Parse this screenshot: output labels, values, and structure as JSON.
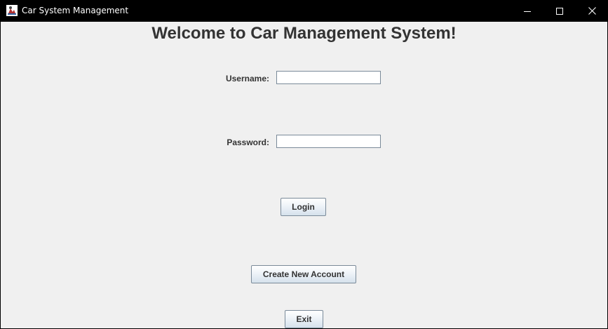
{
  "window": {
    "title": "Car System Management",
    "icon": "app-java-icon"
  },
  "heading": "Welcome to Car Management System!",
  "form": {
    "username_label": "Username:",
    "username_value": "",
    "password_label": "Password:",
    "password_value": ""
  },
  "buttons": {
    "login": "Login",
    "create_account": "Create New Account",
    "exit": "Exit"
  },
  "colors": {
    "titlebar": "#000000",
    "background": "#f0f0f0",
    "text": "#333333"
  }
}
